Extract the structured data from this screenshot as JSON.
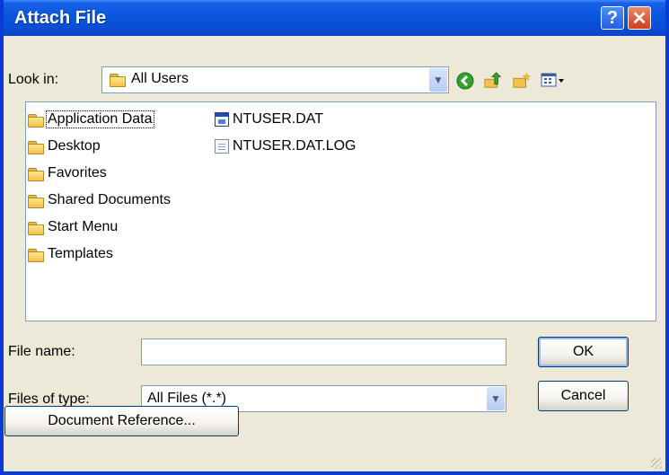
{
  "window": {
    "title": "Attach File"
  },
  "titlebar": {
    "help_glyph": "?",
    "close_glyph": "✕"
  },
  "look_in": {
    "label": "Look in:",
    "value": "All Users"
  },
  "toolbar": {
    "icons": [
      "back-icon",
      "up-folder-icon",
      "new-folder-icon",
      "view-menu-icon"
    ]
  },
  "items": {
    "folders": [
      {
        "label": "Application Data",
        "selected": true
      },
      {
        "label": "Desktop"
      },
      {
        "label": "Favorites"
      },
      {
        "label": "Shared Documents"
      },
      {
        "label": "Start Menu"
      },
      {
        "label": "Templates"
      }
    ],
    "files": [
      {
        "label": "NTUSER.DAT",
        "icon": "dat-file-icon"
      },
      {
        "label": "NTUSER.DAT.LOG",
        "icon": "text-file-icon"
      }
    ]
  },
  "file_name": {
    "label": "File name:",
    "value": ""
  },
  "files_of_type": {
    "label": "Files of type:",
    "value": "All Files (*.*)"
  },
  "buttons": {
    "ok": "OK",
    "cancel": "Cancel",
    "document_reference": "Document Reference..."
  },
  "colors": {
    "title_bar": "#0a4ed4",
    "dialog_bg": "#ece9d8",
    "border_blue": "#0a3bd6"
  }
}
